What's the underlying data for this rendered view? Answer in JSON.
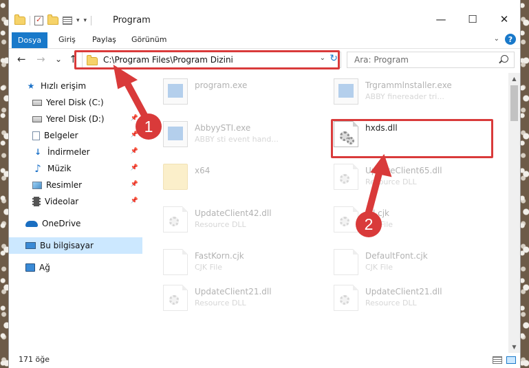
{
  "window": {
    "title": "Program",
    "minimize_glyph": "—",
    "maximize_glyph": "☐",
    "close_glyph": "✕",
    "qat_dropdown_glyph": "▾",
    "qat_customize_glyph": "▾"
  },
  "ribbon": {
    "tabs": [
      "Dosya",
      "Giriş",
      "Paylaş",
      "Görünüm"
    ],
    "expand_glyph": "⌄",
    "help_glyph": "?"
  },
  "nav": {
    "back": "←",
    "forward": "→",
    "recent": "⌄",
    "up": "↑",
    "address": "C:\\Program Files\\Program Dizini",
    "address_dropdown": "⌄",
    "refresh": "↻",
    "search_placeholder": "Ara: Program"
  },
  "sidebar": {
    "items": [
      {
        "label": "Hızlı erişim",
        "icon": "star-icon",
        "pinned": false
      },
      {
        "label": "Yerel Disk (C:)",
        "icon": "drive-icon",
        "pinned": false
      },
      {
        "label": "Yerel Disk (D:)",
        "icon": "drive-icon",
        "pinned": true
      },
      {
        "label": "Belgeler",
        "icon": "document-icon",
        "pinned": true
      },
      {
        "label": "İndirmeler",
        "icon": "download-icon",
        "pinned": true
      },
      {
        "label": "Müzik",
        "icon": "music-icon",
        "pinned": true
      },
      {
        "label": "Resimler",
        "icon": "picture-icon",
        "pinned": true
      },
      {
        "label": "Videolar",
        "icon": "video-icon",
        "pinned": true
      },
      {
        "label": "OneDrive",
        "icon": "cloud-icon",
        "pinned": false
      },
      {
        "label": "Bu bilgisayar",
        "icon": "computer-icon",
        "pinned": false,
        "selected": true
      },
      {
        "label": "Ağ",
        "icon": "network-icon",
        "pinned": false
      }
    ],
    "pin_glyph": "📌"
  },
  "files": [
    {
      "name": "program.exe",
      "desc": "",
      "type": "exe-installer"
    },
    {
      "name": "Trgrammlnstaller.exe",
      "desc": "ABBY finereader tri...",
      "type": "exe"
    },
    {
      "name": "AbbyySTI.exe",
      "desc": "ABBY sti event hand...",
      "type": "exe"
    },
    {
      "name": "hxds.dll",
      "desc": "",
      "type": "dll"
    },
    {
      "name": "x64",
      "desc": "",
      "type": "folder"
    },
    {
      "name": "UpdateClient65.dll",
      "desc": "Resource DLL",
      "type": "dll"
    },
    {
      "name": "UpdateClient42.dll",
      "desc": "Resource DLL",
      "type": "dll"
    },
    {
      "name": "dll.cjk",
      "desc": "CJK File",
      "type": "file"
    },
    {
      "name": "FastKorn.cjk",
      "desc": "CJK File",
      "type": "file"
    },
    {
      "name": "DefaultFont.cjk",
      "desc": "CJK File",
      "type": "file"
    },
    {
      "name": "UpdateClient21.dll",
      "desc": "Resource DLL",
      "type": "dll"
    },
    {
      "name": "UpdateClient21.dll",
      "desc": "Resource DLL",
      "type": "dll"
    }
  ],
  "status": {
    "count": "171 öğe"
  },
  "callouts": {
    "step1": "1",
    "step2": "2",
    "color": "#d93a3a"
  },
  "colors": {
    "accent": "#1979ca",
    "selection": "#cce8ff"
  }
}
